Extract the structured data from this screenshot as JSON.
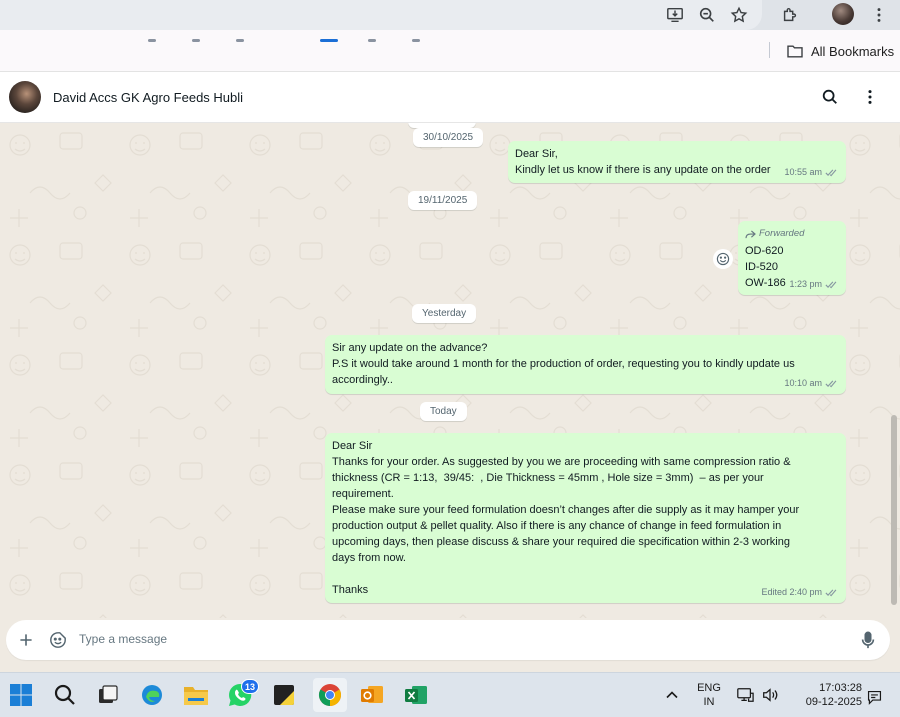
{
  "browser": {
    "bookmarks_label": "All Bookmarks"
  },
  "chat_header": {
    "contact_name": "David Accs GK Agro Feeds Hubli"
  },
  "messages": [
    {
      "date": "30/10/2025",
      "lines": [
        "Dear Sir,",
        "Kindly let us know if there is any update on the order"
      ],
      "time": "10:55 am"
    },
    {
      "date": "19/11/2025",
      "forwarded_label": "Forwarded",
      "lines": [
        "OD-620",
        "ID-520",
        "OW-186"
      ],
      "time": "1:23 pm"
    },
    {
      "date": "Yesterday",
      "lines": [
        "Sir any update on the advance?",
        "P.S it would take around 1 month for the production of order, requesting you to kindly update us",
        "accordingly.."
      ],
      "time": "10:10 am"
    },
    {
      "date": "Today",
      "lines": [
        "Dear Sir",
        "Thanks for your order. As suggested by you we are proceeding with same compression ratio &",
        "thickness (CR = 1:13,  39/45:  , Die Thickness = 45mm , Hole size = 3mm)  – as per your",
        "requirement.",
        "Please make sure your feed formulation doesn’t changes after die supply as it may hamper your",
        "production output & pellet quality. Also if there is any chance of change in feed formulation in",
        "upcoming days, then please discuss & share your required die specification within 2-3 working",
        "days from now.",
        "",
        "Thanks"
      ],
      "time": "Edited 2:40 pm"
    }
  ],
  "composer": {
    "placeholder": "Type a message"
  },
  "taskbar": {
    "whatsapp_badge": "13",
    "language_top": "ENG",
    "language_bottom": "IN",
    "time": "17:03:28",
    "date": "09-12-2025"
  },
  "colors": {
    "outgoing_bubble": "#d9fdd3",
    "chat_background": "#efeae2",
    "read_ticks": "#8696a0"
  }
}
